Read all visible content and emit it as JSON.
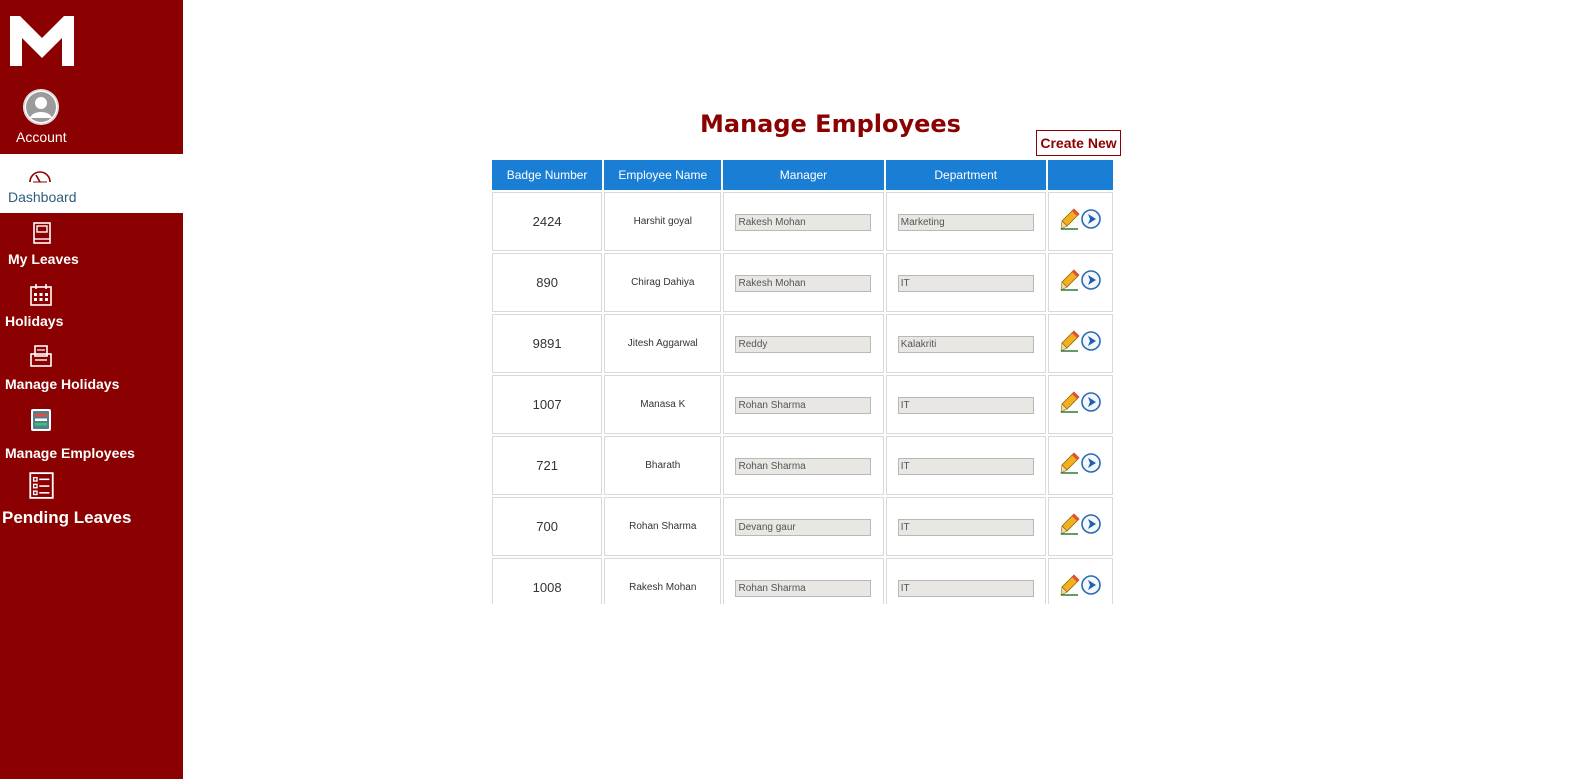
{
  "sidebar": {
    "account_label": "Account",
    "items": [
      {
        "label": "Dashboard",
        "icon": "speedometer-icon",
        "active": true
      },
      {
        "label": "My Leaves",
        "icon": "book-icon",
        "active": false
      },
      {
        "label": "Holidays",
        "icon": "calendar-icon",
        "active": false
      },
      {
        "label": "Manage Holidays",
        "icon": "printer-icon",
        "active": false
      },
      {
        "label": "Manage Employees",
        "icon": "document-list-icon",
        "active": false
      },
      {
        "label": "Pending Leaves",
        "icon": "checklist-icon",
        "active": false
      }
    ]
  },
  "main": {
    "title": "Manage Employees",
    "create_label": "Create New",
    "columns": [
      "Badge Number",
      "Employee Name",
      "Manager",
      "Department",
      ""
    ],
    "rows": [
      {
        "badge": "2424",
        "name": "Harshit goyal",
        "manager": "Rakesh Mohan",
        "department": "Marketing"
      },
      {
        "badge": "890",
        "name": "Chirag Dahiya",
        "manager": "Rakesh Mohan",
        "department": "IT"
      },
      {
        "badge": "9891",
        "name": "Jitesh Aggarwal",
        "manager": "Reddy",
        "department": "Kalakriti"
      },
      {
        "badge": "1007",
        "name": "Manasa K",
        "manager": "Rohan Sharma",
        "department": "IT"
      },
      {
        "badge": "721",
        "name": "Bharath",
        "manager": "Rohan Sharma",
        "department": "IT"
      },
      {
        "badge": "700",
        "name": "Rohan Sharma",
        "manager": "Devang gaur",
        "department": "IT"
      },
      {
        "badge": "1008",
        "name": "Rakesh Mohan",
        "manager": "Rohan Sharma",
        "department": "IT"
      }
    ]
  },
  "colors": {
    "sidebar": "#8b0000",
    "header": "#1a7fd4",
    "title": "#8b0000"
  }
}
